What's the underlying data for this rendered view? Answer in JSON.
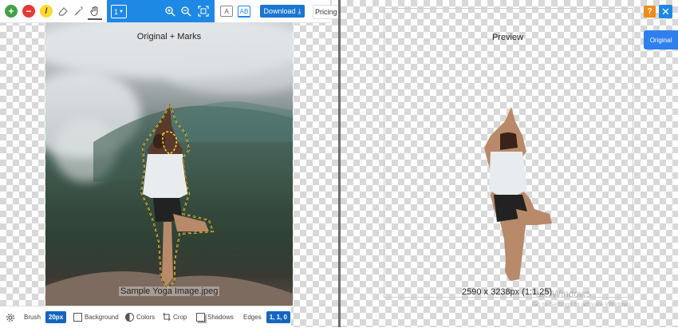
{
  "toolbar": {
    "brush_size_select": "1",
    "download_label": "Download",
    "pricing_label": "Pricing"
  },
  "left_panel": {
    "title": "Original + Marks",
    "file_name": "Sample Yoga Image.jpeg"
  },
  "bottom_bar": {
    "brush_label": "Brush",
    "brush_value": "20px",
    "background_label": "Background",
    "colors_label": "Colors",
    "crop_label": "Crop",
    "shadows_label": "Shadows",
    "edges_label": "Edges",
    "edges_value": "1, 1, 0"
  },
  "right_panel": {
    "title": "Preview",
    "dimensions": "2590 x 3238px (1:1.25)",
    "help_label": "?",
    "close_label": "✕",
    "original_label": "Original",
    "watermark_line1": "ate Windows",
    "watermark_line2": "Go to Settings to activate Windows."
  },
  "colors": {
    "accent_blue": "#1e88e5",
    "download_blue": "#1976d2",
    "help_orange": "#ef8c1a",
    "add_green": "#43a047",
    "remove_red": "#e53935",
    "brush_yellow": "#fdd835"
  }
}
